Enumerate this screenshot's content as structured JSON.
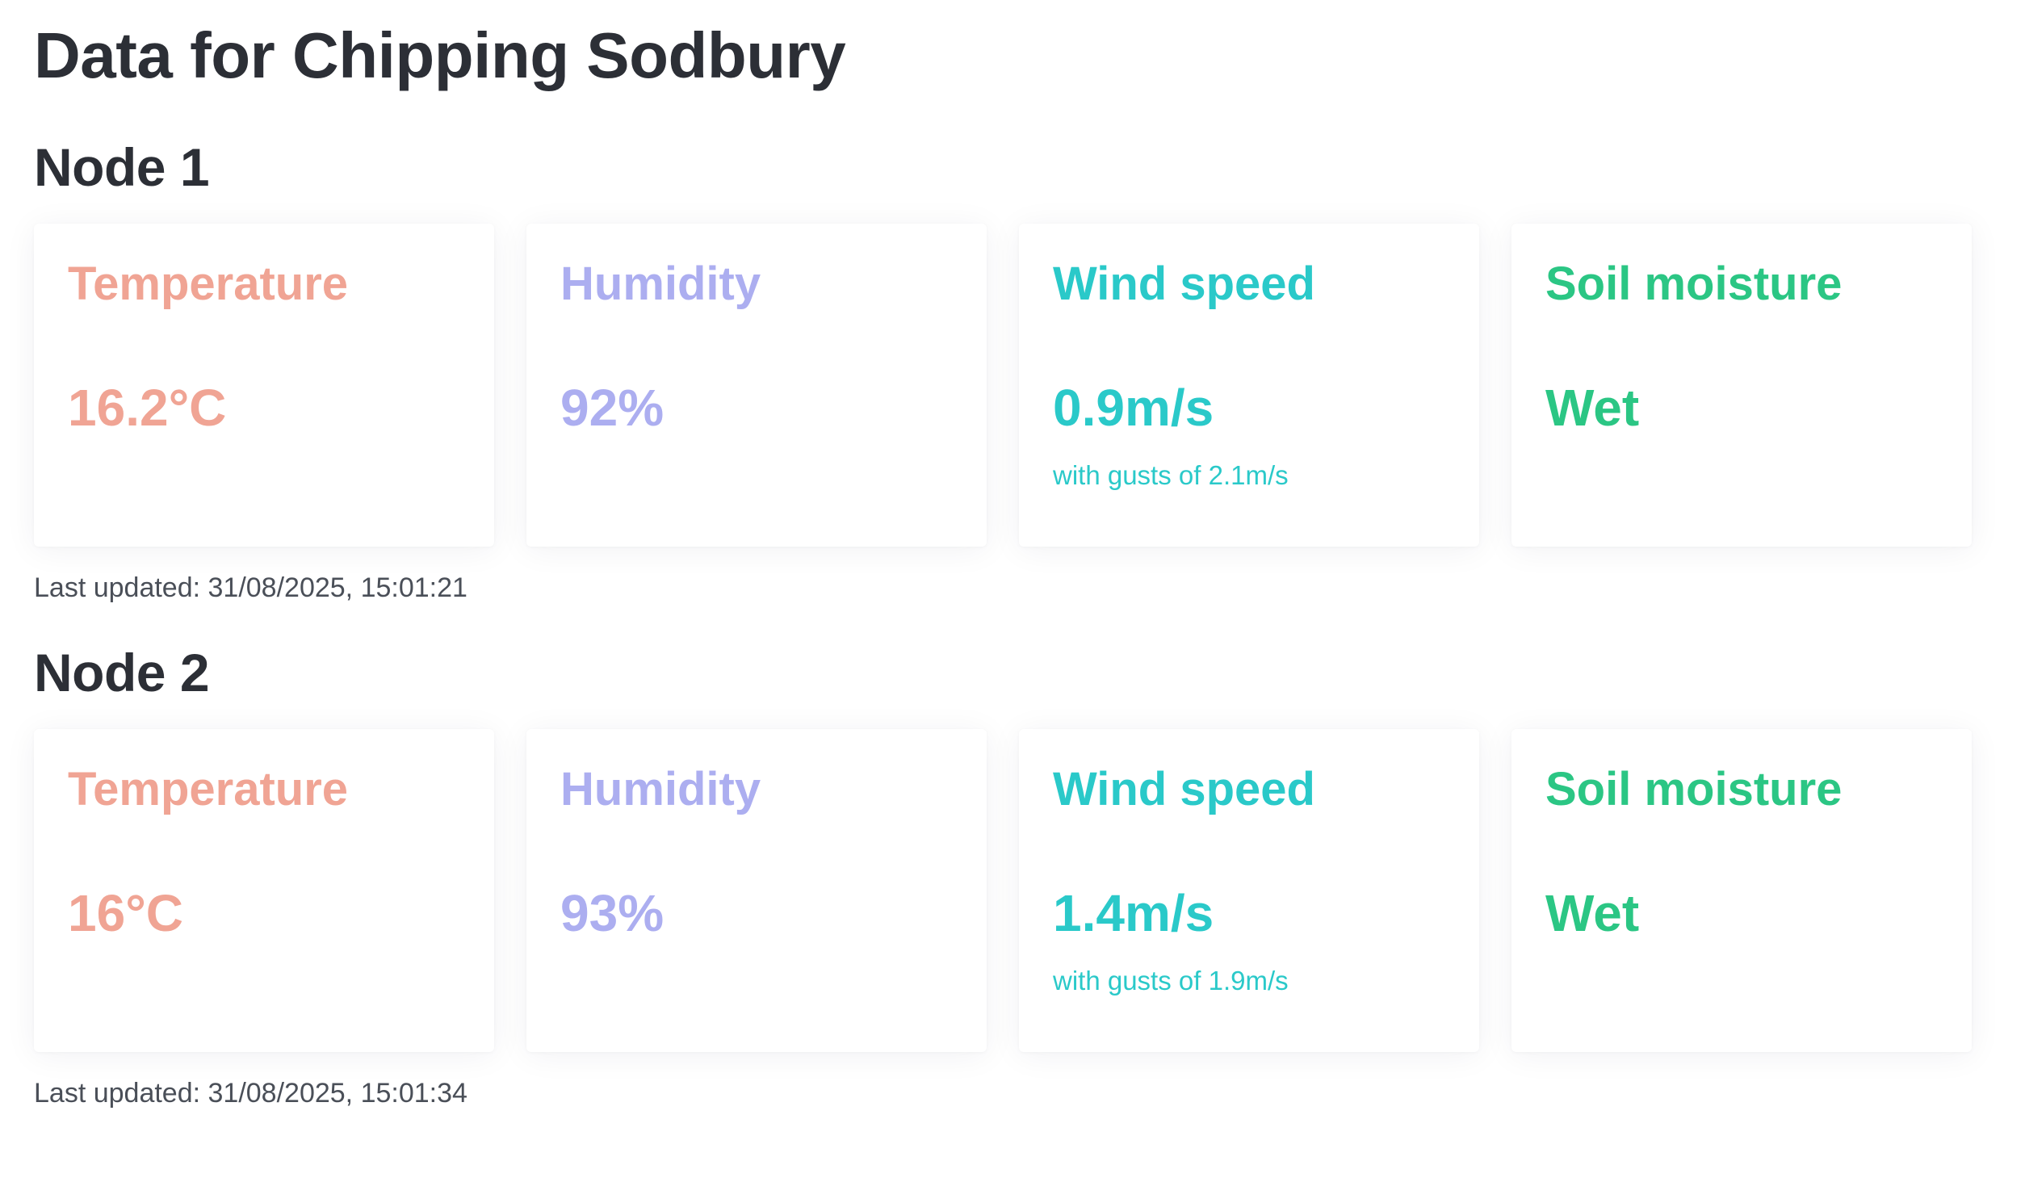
{
  "page": {
    "title": "Data for Chipping Sodbury"
  },
  "colors": {
    "temperature": "#f0a494",
    "humidity": "#acaef0",
    "wind": "#2ac9c9",
    "soil": "#2bc684",
    "heading": "#2c2f36"
  },
  "nodes": [
    {
      "name": "Node 1",
      "temperature": {
        "label": "Temperature",
        "value": "16.2°C"
      },
      "humidity": {
        "label": "Humidity",
        "value": "92%"
      },
      "wind": {
        "label": "Wind speed",
        "value": "0.9m/s",
        "gusts": "with gusts of 2.1m/s"
      },
      "soil": {
        "label": "Soil moisture",
        "value": "Wet"
      },
      "updated": "Last updated: 31/08/2025, 15:01:21"
    },
    {
      "name": "Node 2",
      "temperature": {
        "label": "Temperature",
        "value": "16°C"
      },
      "humidity": {
        "label": "Humidity",
        "value": "93%"
      },
      "wind": {
        "label": "Wind speed",
        "value": "1.4m/s",
        "gusts": "with gusts of 1.9m/s"
      },
      "soil": {
        "label": "Soil moisture",
        "value": "Wet"
      },
      "updated": "Last updated: 31/08/2025, 15:01:34"
    }
  ]
}
